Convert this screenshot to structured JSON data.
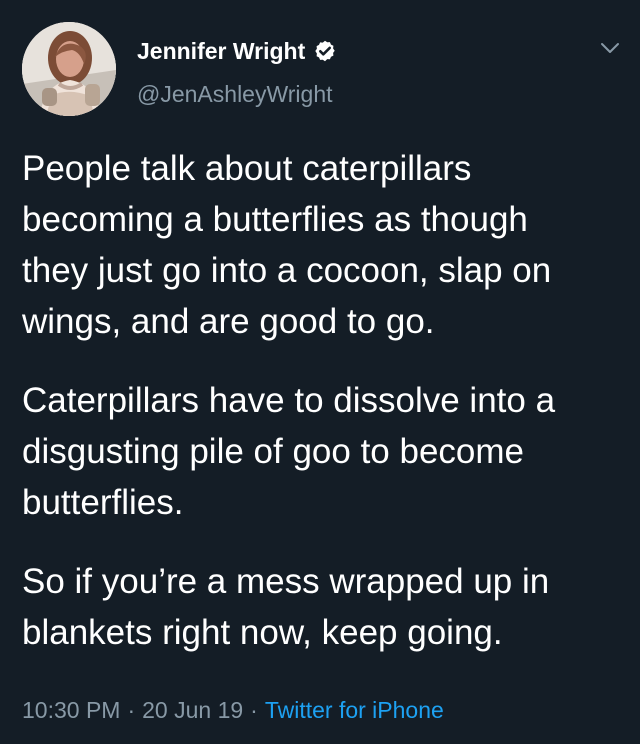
{
  "colors": {
    "background": "#141d26",
    "primary_text": "#ffffff",
    "secondary_text": "#8899a6",
    "link": "#1da1f2"
  },
  "tweet": {
    "author": {
      "name": "Jennifer Wright",
      "handle": "@JenAshleyWright",
      "verified_icon": "verified-badge-icon",
      "avatar": "profile-photo"
    },
    "menu_icon": "chevron-down-icon",
    "paragraphs": [
      "People talk about caterpillars\nbecoming a butterflies as though\nthey just go into a cocoon, slap on\nwings, and are good to go.",
      "Caterpillars have to dissolve into a\ndisgusting pile of goo to become\nbutterflies.",
      "So if you’re a mess wrapped up in\nblankets right now, keep going."
    ],
    "meta": {
      "time": "10:30 PM",
      "separator": "·",
      "date": "20 Jun 19",
      "source": "Twitter for iPhone"
    }
  }
}
